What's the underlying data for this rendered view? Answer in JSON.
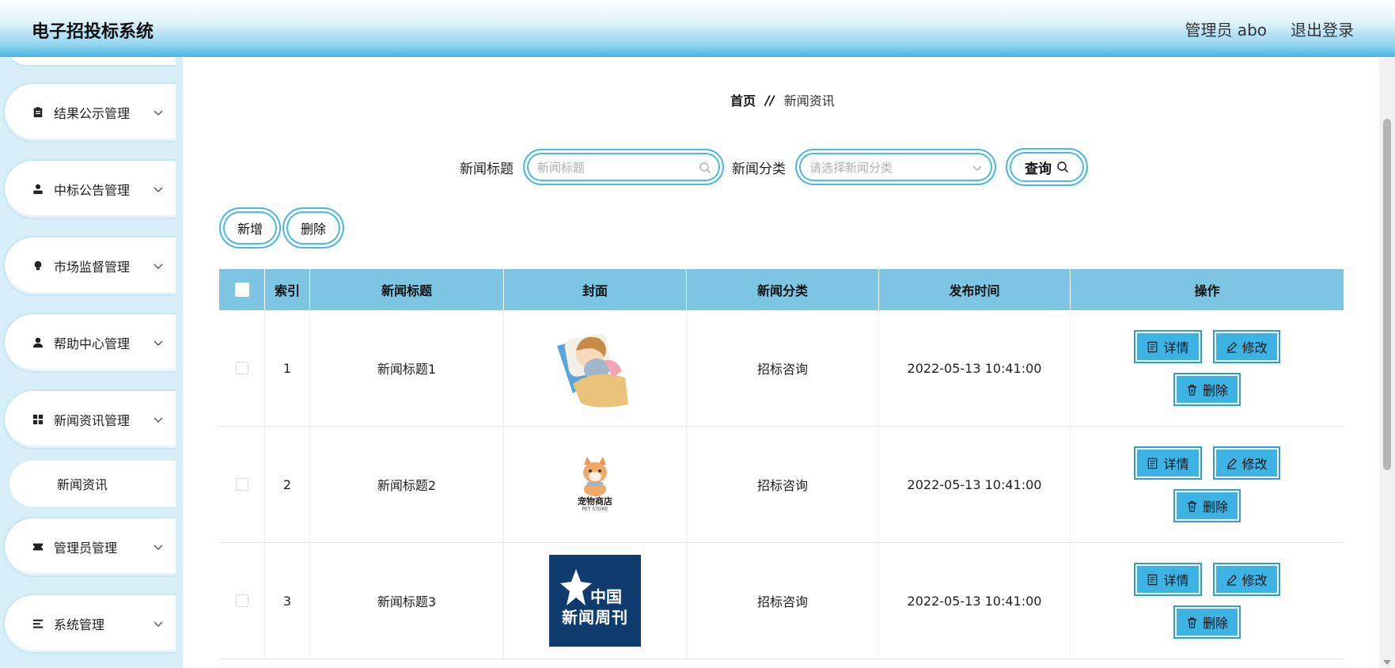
{
  "header": {
    "app_title": "电子招投标系统",
    "user_label": "管理员 abo",
    "logout_label": "退出登录"
  },
  "sidebar": {
    "items": [
      {
        "label": "结果公示管理",
        "icon": "clipboard-icon"
      },
      {
        "label": "中标公告管理",
        "icon": "user-icon"
      },
      {
        "label": "市场监督管理",
        "icon": "bulb-icon"
      },
      {
        "label": "帮助中心管理",
        "icon": "person-icon"
      },
      {
        "label": "新闻资讯管理",
        "icon": "grid-icon"
      },
      {
        "label": "管理员管理",
        "icon": "ticket-icon"
      },
      {
        "label": "系统管理",
        "icon": "list-icon"
      }
    ],
    "sub_item": "新闻资讯"
  },
  "breadcrumb": {
    "home": "首页",
    "separator": "//",
    "current": "新闻资讯"
  },
  "search": {
    "title_label": "新闻标题",
    "title_placeholder": "新闻标题",
    "category_label": "新闻分类",
    "category_placeholder": "请选择新闻分类",
    "query_label": "查询"
  },
  "actions": {
    "add_label": "新增",
    "delete_label": "删除"
  },
  "table": {
    "columns": [
      "索引",
      "新闻标题",
      "封面",
      "新闻分类",
      "发布时间",
      "操作"
    ],
    "rows": [
      {
        "index": "1",
        "title": "新闻标题1",
        "category": "招标咨询",
        "time": "2022-05-13 10:41:00",
        "cover": "sleeping-girl-image"
      },
      {
        "index": "2",
        "title": "新闻标题2",
        "category": "招标咨询",
        "time": "2022-05-13 10:41:00",
        "cover": "pet-store-logo",
        "cover_text": "宠物商店",
        "cover_subtext": "PET STORE"
      },
      {
        "index": "3",
        "title": "新闻标题3",
        "category": "招标咨询",
        "time": "2022-05-13 10:41:00",
        "cover": "china-newsweek-logo",
        "cover_text_1": "中国",
        "cover_text_2": "新闻周刊"
      }
    ],
    "op_detail": "详情",
    "op_edit": "修改",
    "op_delete": "删除"
  },
  "colors": {
    "header_gradient_end": "#46b6e4",
    "sidebar_bg": "#d7edf8",
    "table_header_bg": "#7cc6e3",
    "op_button_bg": "#3db3e3",
    "newsweek_bg": "#0f3b6e"
  }
}
